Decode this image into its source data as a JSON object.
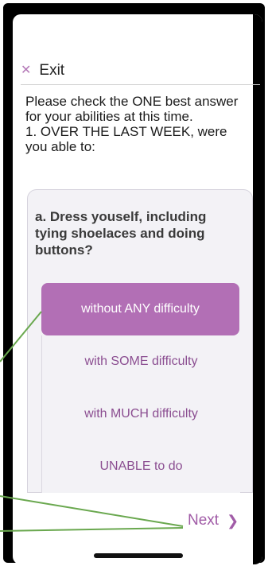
{
  "header": {
    "exit_icon": "close-icon",
    "exit_label": "Exit"
  },
  "instructions": {
    "text": "Please check the ONE best answer for your abilities at this time.\n1. OVER THE LAST WEEK, were you able to:"
  },
  "question": {
    "text": "a. Dress youself, including tying shoelaces and doing buttons?"
  },
  "options": [
    {
      "label": "without ANY difficulty",
      "selected": true
    },
    {
      "label": "with SOME difficulty",
      "selected": false
    },
    {
      "label": "with MUCH difficulty",
      "selected": false
    },
    {
      "label": "UNABLE to do",
      "selected": false
    }
  ],
  "footer": {
    "next_label": "Next",
    "next_icon": "chevron-right-icon"
  },
  "colors": {
    "accent": "#b26fb5",
    "accent_text": "#8b4e91",
    "card_bg": "#f3f2f6",
    "annotation_arrow": "#6aa84f"
  }
}
